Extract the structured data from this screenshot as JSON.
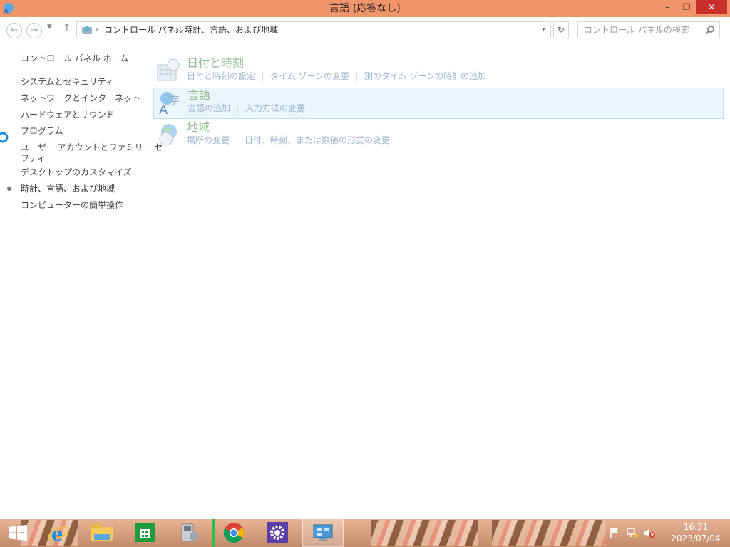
{
  "window": {
    "title": "言語 (応答なし)",
    "controls": {
      "minimize": "–",
      "maximize": "❐",
      "close": "✕"
    }
  },
  "navbar": {
    "back_icon": "←",
    "forward_icon": "→",
    "dropdown_icon": "▼",
    "up_icon": "↑",
    "breadcrumb": [
      {
        "label": "コントロール パネル"
      },
      {
        "label": "時計、言語、および地域"
      }
    ],
    "sep_icon": "›",
    "address_dropdown_icon": "▾",
    "refresh_icon": "↻",
    "search_placeholder": "コントロール パネルの検索"
  },
  "sidebar": {
    "home": "コントロール パネル ホーム",
    "items": [
      {
        "label": "システムとセキュリティ"
      },
      {
        "label": "ネットワークとインターネット"
      },
      {
        "label": "ハードウェアとサウンド"
      },
      {
        "label": "プログラム"
      },
      {
        "label": "ユーザー アカウントとファミリー セー"
      },
      {
        "label": "フティ"
      },
      {
        "label": "デスクトップのカスタマイズ"
      },
      {
        "label": "時計、言語、および地域"
      },
      {
        "label": "コンピューターの簡単操作"
      }
    ]
  },
  "categories": [
    {
      "name": "日付と時刻",
      "links": [
        "日付と時刻の設定",
        "タイム ゾーンの変更",
        "別のタイム ゾーンの時計の追加"
      ]
    },
    {
      "name": "言語",
      "links": [
        "言語の追加",
        "入力方法の変更"
      ]
    },
    {
      "name": "地域",
      "links": [
        "場所の変更",
        "日付、時刻、または数値の形式の変更"
      ]
    }
  ],
  "taskbar": {
    "time": "16:31",
    "date": "2023/07/04"
  },
  "colors": {
    "titlebar": "#f1946a",
    "close": "#c7302b",
    "category_name": "#8fbe8f",
    "link": "#9cb4d0"
  }
}
